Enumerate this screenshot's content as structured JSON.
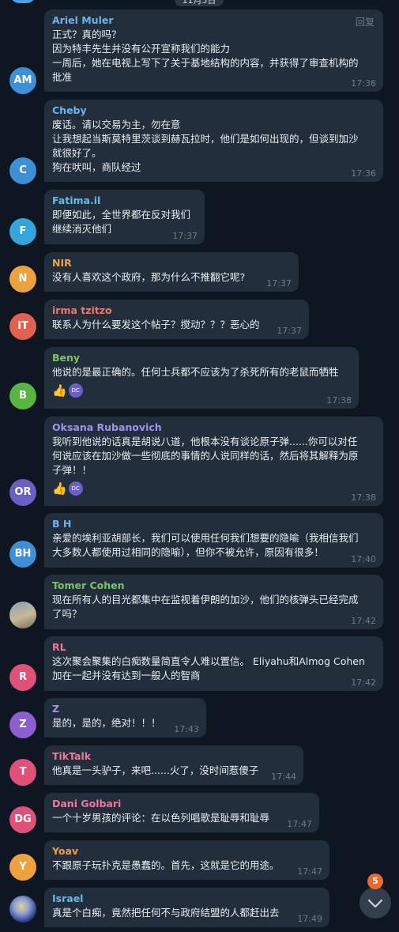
{
  "header": {
    "date_pill": "11月5日"
  },
  "actions": {
    "reply_label": "回复"
  },
  "colors": {
    "background": "#0e1621",
    "bubble": "#232e3c",
    "time": "#6d7b8a",
    "badge": "#e66b2d"
  },
  "messages": [
    {
      "sender": "Ariel Muler",
      "initials": "AM",
      "lines": [
        "正式？真的吗？",
        "因为特丰先生并没有公开宣称我们的能力",
        "一周后，她在电视上写下了关于基地结构的内容，并获得了审查机构的",
        "批准"
      ],
      "time": "17:36"
    },
    {
      "sender": "Cheby",
      "initials": "C",
      "lines": [
        "废话。请以交易为主，勿在意",
        "让我想起当斯莫特里茨谈到赫瓦拉时，他们是如何出现的，但谈到加沙",
        "就很好了。",
        "狗在吠叫，商队经过"
      ],
      "time": "17:36"
    },
    {
      "sender": "Fatima.il",
      "initials": "F",
      "lines": [
        "即便如此，全世界都在反对我们",
        "继续消灭他们"
      ],
      "time": "17:37"
    },
    {
      "sender": "NIR",
      "initials": "N",
      "lines": [
        "没有人喜欢这个政府，那为什么不推翻它呢?"
      ],
      "time": "17:37"
    },
    {
      "sender": "irma tzitzo",
      "initials": "IT",
      "lines": [
        "联系人为什么要发这个帖子？搅动？？？恶心的"
      ],
      "time": "17:37"
    },
    {
      "sender": "Beny",
      "initials": "B",
      "lines": [
        "他说的是最正确的。任何士兵都不应该为了杀死所有的老鼠而牺牲"
      ],
      "reactions": [
        "👍",
        "DC"
      ],
      "time": "17:38"
    },
    {
      "sender": "Oksana Rubanovich",
      "initials": "OR",
      "lines": [
        "我听到他说的话真是胡说八道，他根本没有谈论原子弹......你可以对任",
        "何说应该在加沙做一些彻底的事情的人说同样的话，然后将其解释为原",
        "子弹！！"
      ],
      "reactions": [
        "👍",
        "DC"
      ],
      "time": "17:38"
    },
    {
      "sender": "B H",
      "initials": "BH",
      "lines": [
        "亲爱的埃利亚胡部长，我们可以使用任何我们想要的隐喻（我相信我们",
        "大多数人都使用过相同的隐喻），但你不被允许，原因有很多！"
      ],
      "time": "17:40"
    },
    {
      "sender": "Tomer Cohen",
      "initials": "",
      "lines": [
        "现在所有人的目光都集中在监视着伊朗的加沙，他们的核弹头已经完成",
        "了吗？"
      ],
      "time": "17:42"
    },
    {
      "sender": "RL",
      "initials": "R",
      "lines": [
        "这次聚会聚集的白痴数量简直令人难以置信。 Eliyahu和Almog Cohen",
        "加在一起并没有达到一般人的智商"
      ],
      "time": "17:42"
    },
    {
      "sender": "Z",
      "initials": "Z",
      "lines": [
        "是的，是的，绝对！！！"
      ],
      "time": "17:43"
    },
    {
      "sender": "TikTalk",
      "initials": "T",
      "lines": [
        "他真是一头驴子，来吧......火了，没时间惹傻子"
      ],
      "time": "17:44"
    },
    {
      "sender": "Dani Golbari",
      "initials": "DG",
      "lines": [
        "一个十岁男孩的评论：在以色列唱歌是耻辱和耻辱"
      ],
      "time": "17:47"
    },
    {
      "sender": "Yoav",
      "initials": "Y",
      "lines": [
        "不跟原子玩扑克是愚蠢的。首先，这就是它的用途。"
      ],
      "time": "17:47"
    },
    {
      "sender": "Israel",
      "initials": "",
      "lines": [
        "真是个白痴，竟然把任何不与政府结盟的人都赶出去"
      ],
      "time": "17:49"
    }
  ],
  "scroll": {
    "unread_count": "5",
    "icon": "chevron-down-icon"
  }
}
